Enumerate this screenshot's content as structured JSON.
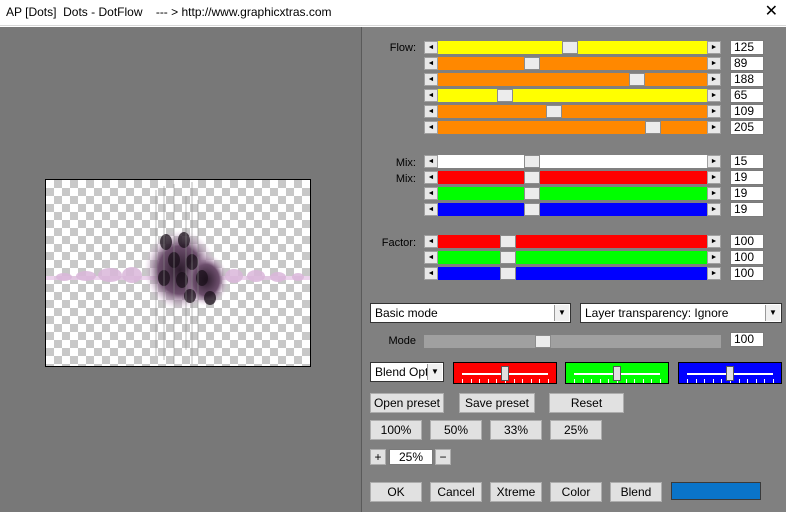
{
  "window": {
    "title": "AP [Dots]  Dots - DotFlow    --- > http://www.graphicxtras.com",
    "close_glyph": "✕"
  },
  "labels": {
    "flow": "Flow:",
    "mix1": "Mix:",
    "mix2": "Mix:",
    "factor": "Factor:",
    "mode": "Mode"
  },
  "sliders": {
    "flow": [
      {
        "value": "125",
        "color": "#ffff00",
        "fraction": 0.49
      },
      {
        "value": "89",
        "color": "#ff8800",
        "fraction": 0.35
      },
      {
        "value": "188",
        "color": "#ff8800",
        "fraction": 0.74
      },
      {
        "value": "65",
        "color": "#ffff00",
        "fraction": 0.25
      },
      {
        "value": "109",
        "color": "#ff8800",
        "fraction": 0.43
      },
      {
        "value": "205",
        "color": "#ff8800",
        "fraction": 0.8
      }
    ],
    "mix": [
      {
        "value": "15",
        "color": "#ffffff",
        "fraction": 0.35
      },
      {
        "value": "19",
        "color": "#ff0000",
        "fraction": 0.35
      },
      {
        "value": "19",
        "color": "#00ff00",
        "fraction": 0.35
      },
      {
        "value": "19",
        "color": "#0000ff",
        "fraction": 0.35
      }
    ],
    "factor": [
      {
        "value": "100",
        "color": "#ff0000",
        "fraction": 0.26
      },
      {
        "value": "100",
        "color": "#00ff00",
        "fraction": 0.26
      },
      {
        "value": "100",
        "color": "#0000ff",
        "fraction": 0.26
      }
    ],
    "mode": {
      "value": "100",
      "color": "#a0a0a0",
      "fraction": 0.4
    }
  },
  "dropdowns": {
    "mode": "Basic mode",
    "layer": "Layer transparency: Ignore",
    "blend": "Blend Optio",
    "arrow_glyph": "▼"
  },
  "color_swatches": [
    {
      "color": "#ff0000",
      "fraction": 0.5
    },
    {
      "color": "#00ff00",
      "fraction": 0.5
    },
    {
      "color": "#0000ff",
      "fraction": 0.5
    }
  ],
  "buttons": {
    "open_preset": "Open preset",
    "save_preset": "Save preset",
    "reset": "Reset",
    "zoom100": "100%",
    "zoom50": "50%",
    "zoom33": "33%",
    "zoom25": "25%",
    "plus": "+",
    "minus": "−",
    "zoom_value": "25%",
    "ok": "OK",
    "cancel": "Cancel",
    "xtreme": "Xtreme",
    "color": "Color",
    "blend": "Blend"
  },
  "accent_color": "#0a74c9"
}
